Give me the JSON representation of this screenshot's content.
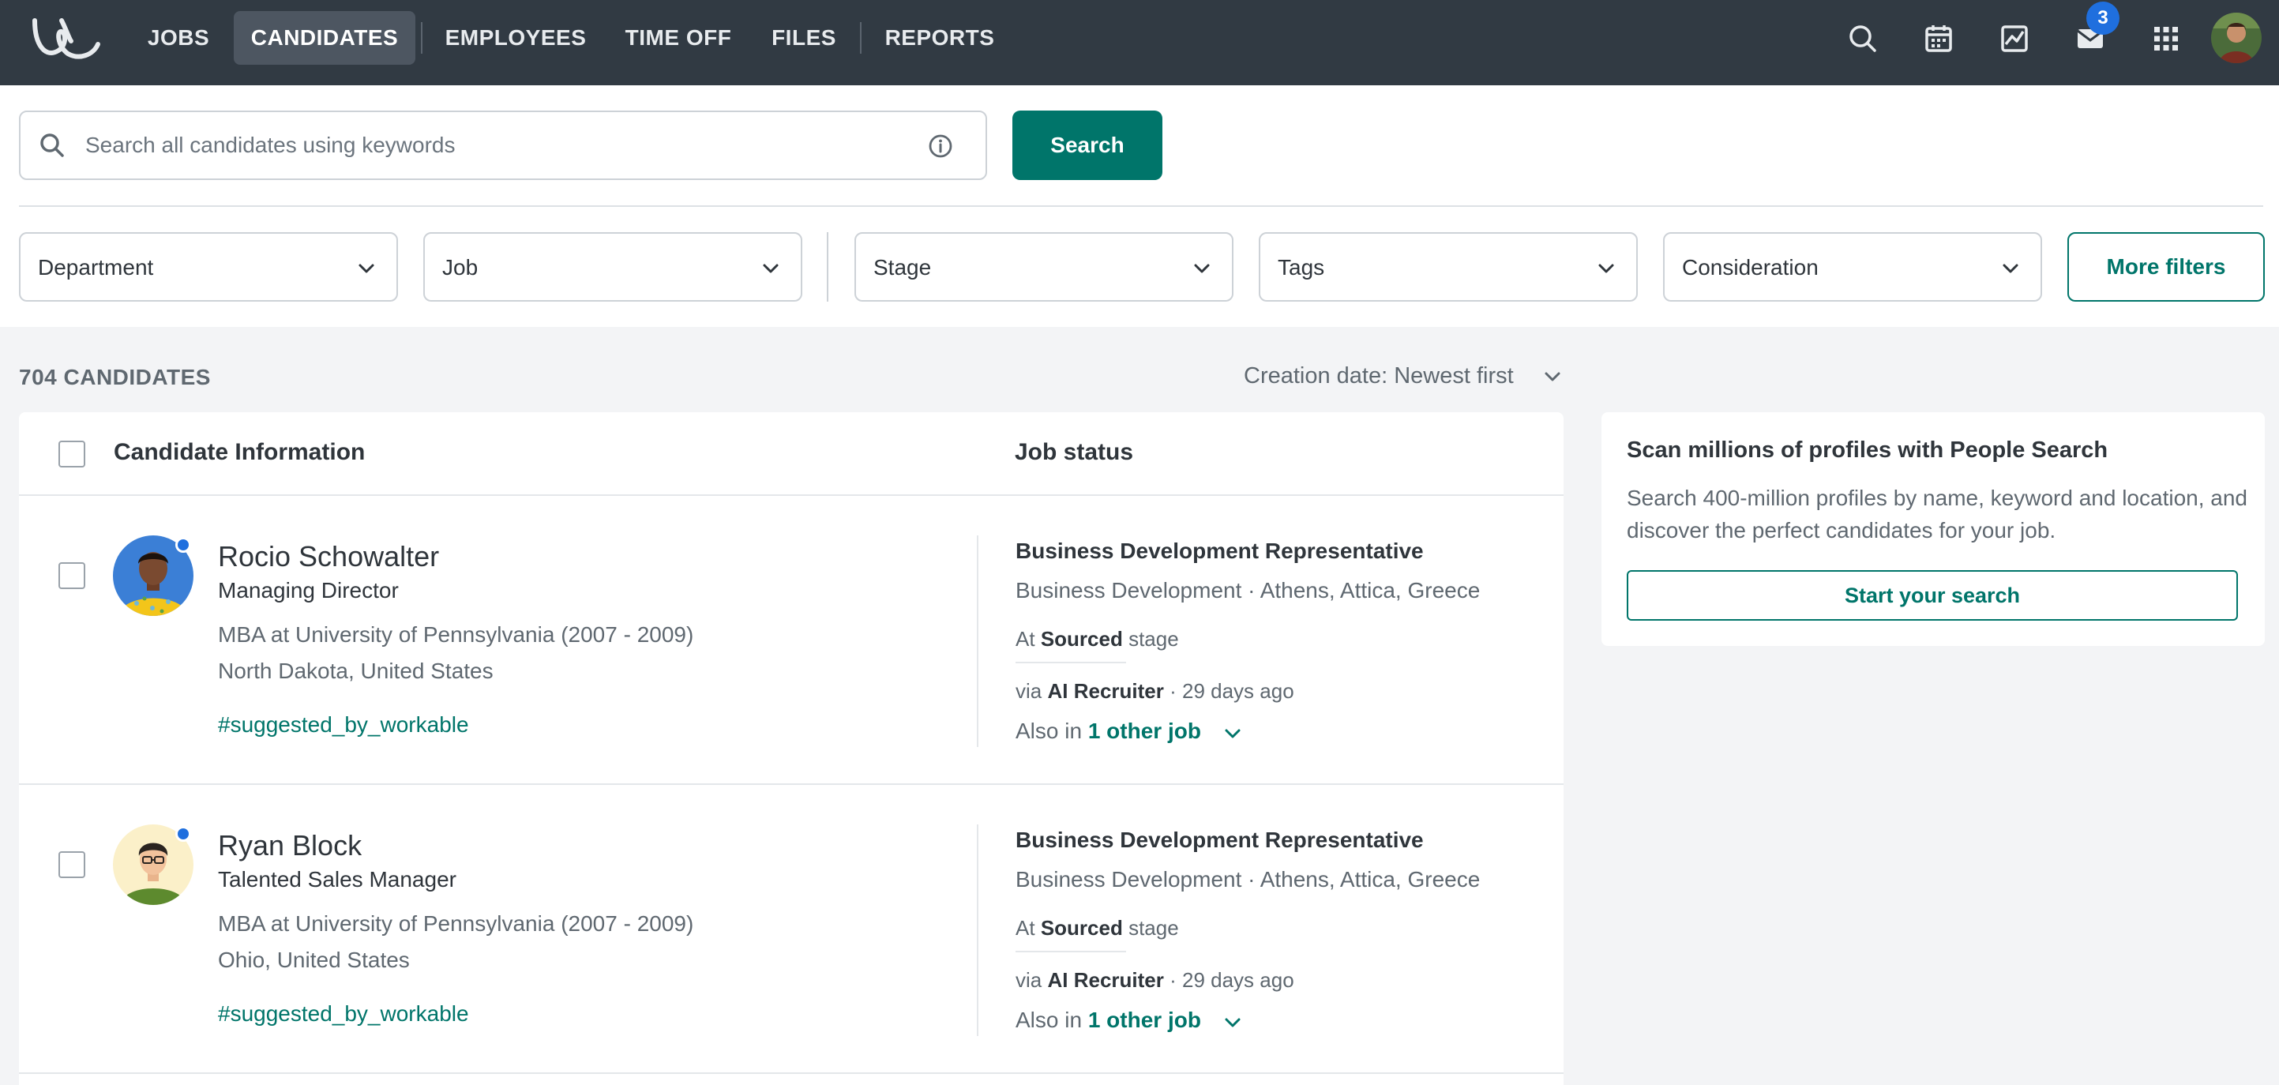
{
  "nav": {
    "tabs": [
      {
        "label": "JOBS"
      },
      {
        "label": "CANDIDATES",
        "active": true
      },
      {
        "label": "EMPLOYEES"
      },
      {
        "label": "TIME OFF"
      },
      {
        "label": "FILES"
      },
      {
        "label": "REPORTS"
      }
    ],
    "icons": [
      "search-icon",
      "calendar-icon",
      "activity-chart-icon",
      "inbox-icon",
      "apps-grid-icon"
    ],
    "inbox_badge": "3"
  },
  "search": {
    "placeholder": "Search all candidates using keywords",
    "button_label": "Search"
  },
  "filters": {
    "department": "Department",
    "job": "Job",
    "stage": "Stage",
    "tags": "Tags",
    "consideration": "Consideration",
    "more": "More filters"
  },
  "list": {
    "count_label": "704 CANDIDATES",
    "sort_label": "Creation date: Newest first",
    "col_candidate": "Candidate Information",
    "col_job_status": "Job status"
  },
  "candidates": [
    {
      "name": "Rocio Schowalter",
      "title": "Managing Director",
      "education": "MBA at University of Pennsylvania (2007 - 2009)",
      "location": "North Dakota, United States",
      "tag": "#suggested_by_workable",
      "job": "Business Development Representative",
      "department": "Business Development · Athens, Attica, Greece",
      "stage_prefix": "At",
      "stage": "Sourced",
      "stage_suffix": "stage",
      "via_prefix": "via",
      "via": "AI Recruiter",
      "via_suffix": "· 29 days ago",
      "also_prefix": "Also in",
      "also_link": "1 other job"
    },
    {
      "name": "Ryan Block",
      "title": "Talented Sales Manager",
      "education": "MBA at University of Pennsylvania (2007 - 2009)",
      "location": "Ohio, United States",
      "tag": "#suggested_by_workable",
      "job": "Business Development Representative",
      "department": "Business Development · Athens, Attica, Greece",
      "stage_prefix": "At",
      "stage": "Sourced",
      "stage_suffix": "stage",
      "via_prefix": "via",
      "via": "AI Recruiter",
      "via_suffix": "· 29 days ago",
      "also_prefix": "Also in",
      "also_link": "1 other job"
    }
  ],
  "people_search": {
    "title": "Scan millions of profiles with People Search",
    "description": "Search 400-million profiles by name, keyword and location, and discover the perfect candidates for your job.",
    "button_label": "Start your search"
  },
  "colors": {
    "nav_bg": "#313a43",
    "accent": "#00756a",
    "badge": "#1f6fde"
  }
}
